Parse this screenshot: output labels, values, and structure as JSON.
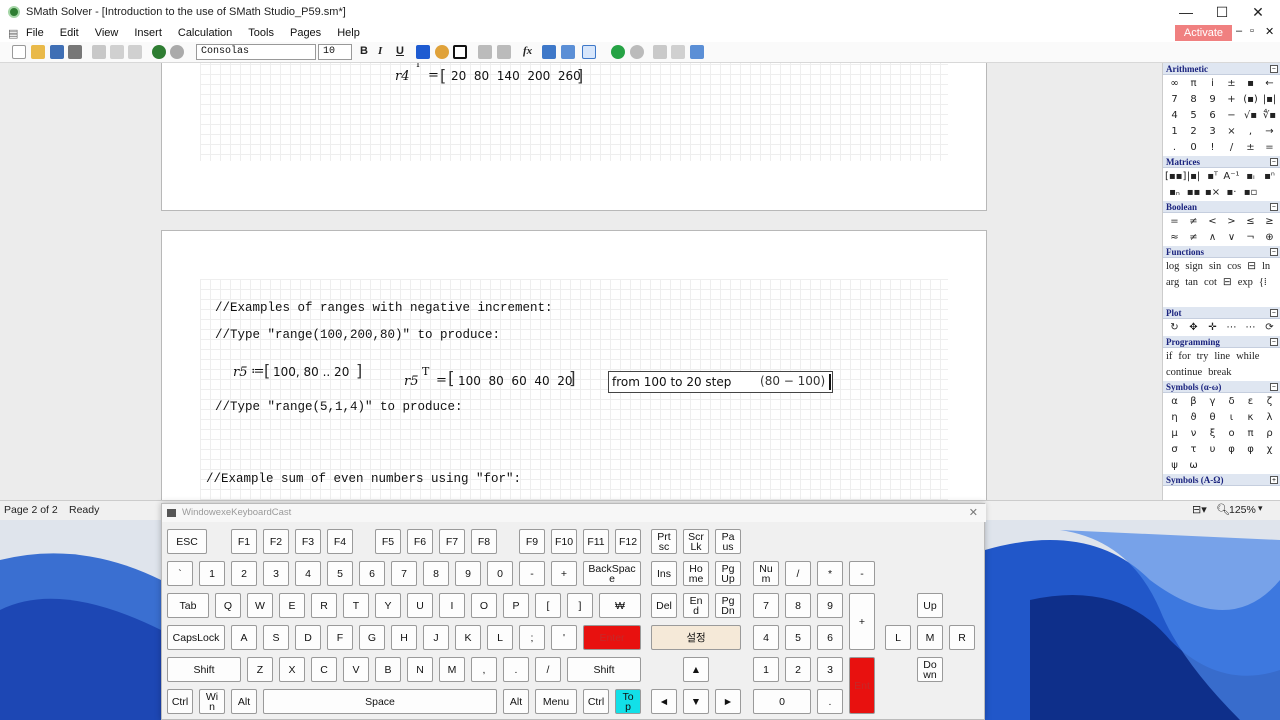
{
  "window": {
    "title": "SMath Solver - [Introduction to the use of SMath Studio_P59.sm*]",
    "controls": {
      "minimize": "—",
      "maximize": "☐",
      "close": "✕"
    }
  },
  "menu": {
    "items": [
      "File",
      "Edit",
      "View",
      "Insert",
      "Calculation",
      "Tools",
      "Pages",
      "Help"
    ],
    "activate_label": "Activate",
    "mdi_controls": [
      "▾",
      "–",
      "▫",
      "✕"
    ]
  },
  "toolbar": {
    "font_name": "Consolas",
    "font_size": "10",
    "bold": "B",
    "italic": "I",
    "underline": "U",
    "fx": "fx"
  },
  "document": {
    "page1": {
      "r4_name": "r4",
      "r4_sup": "T",
      "r4_eq": "=",
      "r4_values": "20  80  140  200  260"
    },
    "page2": {
      "comment1": "//Examples of ranges with negative increment:",
      "comment2": "//Type \"range(100,200,80)\" to produce:",
      "r5_def_name": "r5",
      "r5_def_op": "≔",
      "r5_def_value": "100, 80 .. 20",
      "r5_res_name": "r5",
      "r5_res_sup": "T",
      "r5_res_eq": "=",
      "r5_res_values": "100  80  60  40  20",
      "tooltip_text": "from 100 to 20 step",
      "tooltip_step": "80 − 100",
      "comment3": "//Type \"range(5,1,4)\" to produce:",
      "comment4": "//Example sum of even numbers using \"for\":"
    }
  },
  "sidebar": {
    "arithmetic": {
      "title": "Arithmetic",
      "keys": [
        "∞",
        "π",
        "i",
        "±",
        "▪",
        "←",
        "7",
        "8",
        "9",
        "+",
        "(▪)",
        "|▪|",
        "4",
        "5",
        "6",
        "−",
        "√▪",
        "∜▪",
        "1",
        "2",
        "3",
        "×",
        ",",
        "→",
        ".",
        " 0",
        "!",
        "/",
        "±",
        "="
      ]
    },
    "matrices": {
      "title": "Matrices",
      "keys": [
        "[▪▪]",
        "|▪|",
        "▪ᵀ",
        "A⁻¹",
        "▪ᵢ",
        "▪ⁿ",
        "▪ₙ",
        "▪▪",
        "▪×",
        "▪·",
        "▪▫",
        ""
      ]
    },
    "boolean": {
      "title": "Boolean",
      "keys": [
        "=",
        "≠",
        "<",
        ">",
        "≤",
        "≥",
        "≈",
        "≠",
        "∧",
        "∨",
        "¬",
        "⊕"
      ]
    },
    "functions": {
      "title": "Functions",
      "words": [
        "log",
        "sign",
        "sin",
        "cos",
        "⊟",
        "ln",
        "arg",
        "tan",
        "cot",
        "⊟",
        "exp",
        "{⁞"
      ]
    },
    "plot": {
      "title": "Plot",
      "keys": [
        "↻",
        "✥",
        "✛",
        "⋯",
        "⋯",
        "⟳"
      ]
    },
    "programming": {
      "title": "Programming",
      "words": [
        "if",
        "for",
        "try",
        "line",
        "while",
        "continue",
        "break"
      ]
    },
    "symbols_lower": {
      "title": "Symbols (α-ω)",
      "keys": [
        "α",
        "β",
        "γ",
        "δ",
        "ε",
        "ζ",
        "η",
        "ϑ",
        "θ",
        "ι",
        "κ",
        "λ",
        "μ",
        "ν",
        "ξ",
        "ο",
        "π",
        "ρ",
        "σ",
        "τ",
        "υ",
        "φ",
        "φ",
        "χ",
        "ψ",
        "ω"
      ]
    },
    "symbols_upper": {
      "title": "Symbols (Α-Ω)"
    }
  },
  "status": {
    "page": "Page 2 of 2",
    "state": "Ready",
    "zoom": "125%"
  },
  "keyboard": {
    "title": "WindowexeKeyboardCast",
    "close": "✕"
  }
}
